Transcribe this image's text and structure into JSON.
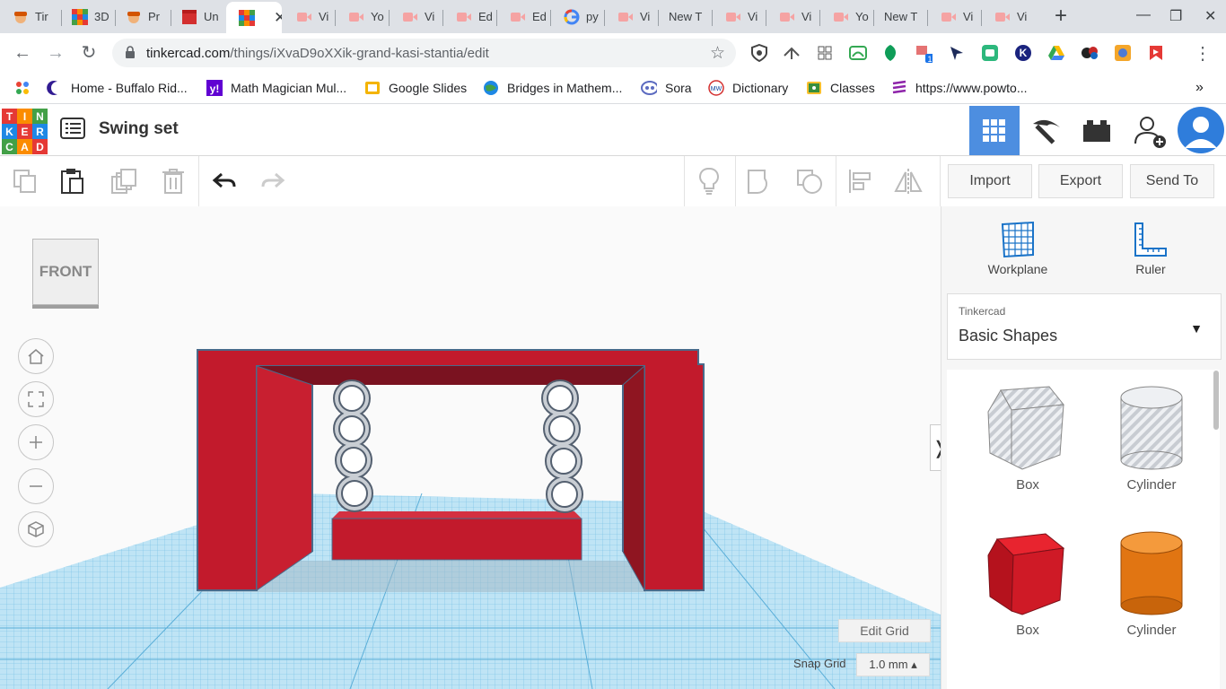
{
  "browser": {
    "tabs": [
      {
        "label": "Tir",
        "icon": "person-hat-icon"
      },
      {
        "label": "3D",
        "icon": "tinkercad-icon"
      },
      {
        "label": "Pr",
        "icon": "person-hat-icon"
      },
      {
        "label": "Un",
        "icon": "clapper-icon"
      },
      {
        "label": "",
        "icon": "tinkercad-icon",
        "active": true
      },
      {
        "label": "Vi",
        "icon": "video-icon"
      },
      {
        "label": "Yo",
        "icon": "video-icon"
      },
      {
        "label": "Vi",
        "icon": "video-icon"
      },
      {
        "label": "Ed",
        "icon": "video-icon"
      },
      {
        "label": "Ed",
        "icon": "video-icon"
      },
      {
        "label": "py",
        "icon": "google-icon"
      },
      {
        "label": "Vi",
        "icon": "video-icon"
      },
      {
        "label": "New T",
        "icon": ""
      },
      {
        "label": "Vi",
        "icon": "video-icon"
      },
      {
        "label": "Vi",
        "icon": "video-icon"
      },
      {
        "label": "Yo",
        "icon": "video-icon"
      },
      {
        "label": "New T",
        "icon": ""
      },
      {
        "label": "Vi",
        "icon": "video-icon"
      },
      {
        "label": "Vi",
        "icon": "video-icon"
      }
    ],
    "url_host": "tinkercad.com",
    "url_path": "/things/iXvaD9oXXik-grand-kasi-stantia/edit",
    "bookmarks": [
      {
        "label": "",
        "icon": "apps-icon"
      },
      {
        "label": "Home - Buffalo Rid...",
        "icon": "moon-icon"
      },
      {
        "label": "Math Magician Mul...",
        "icon": "yahoo-icon"
      },
      {
        "label": "Google Slides",
        "icon": "slides-icon"
      },
      {
        "label": "Bridges in Mathem...",
        "icon": "globe-icon"
      },
      {
        "label": "Sora",
        "icon": "sora-icon"
      },
      {
        "label": "Dictionary",
        "icon": "mw-icon"
      },
      {
        "label": "Classes",
        "icon": "classes-icon"
      },
      {
        "label": "https://www.powto...",
        "icon": "powtoon-icon"
      }
    ],
    "badge_count": "1"
  },
  "tinkercad": {
    "logo_letters": [
      "T",
      "I",
      "N",
      "K",
      "E",
      "R",
      "C",
      "A",
      "D"
    ],
    "design_title": "Swing set",
    "actions": {
      "import": "Import",
      "export": "Export",
      "send_to": "Send To"
    },
    "viewcube_label": "FRONT",
    "edit_grid": "Edit Grid",
    "snap_grid_label": "Snap Grid",
    "snap_grid_value": "1.0 mm ▴",
    "panel": {
      "workplane": "Workplane",
      "ruler": "Ruler",
      "library_source": "Tinkercad",
      "library_name": "Basic Shapes",
      "shapes": [
        {
          "label": "Box",
          "kind": "hole-box"
        },
        {
          "label": "Cylinder",
          "kind": "hole-cylinder"
        },
        {
          "label": "Box",
          "kind": "solid-box"
        },
        {
          "label": "Cylinder",
          "kind": "solid-cylinder"
        }
      ]
    },
    "colors": {
      "accent": "#4d8ee0",
      "model_red": "#c0152a",
      "grid_blue": "#8ecdea",
      "orange": "#e87a1a"
    }
  }
}
